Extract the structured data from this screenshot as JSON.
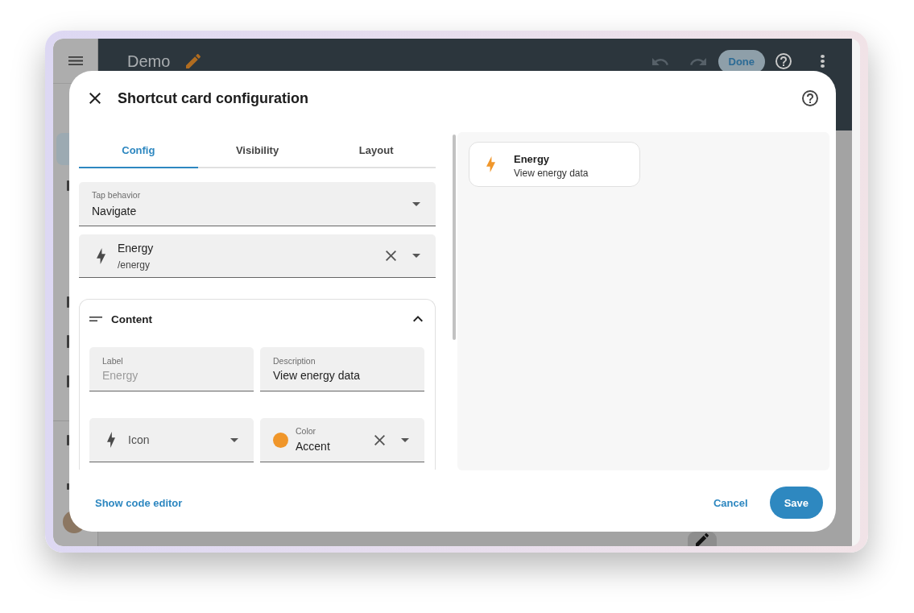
{
  "background_app": {
    "sidebar": {
      "items": [
        {
          "selected": true
        },
        {
          "selected": false
        },
        {
          "selected": false
        },
        {
          "selected": false
        },
        {
          "selected": false
        },
        {
          "selected": false
        },
        {
          "selected": false
        }
      ]
    },
    "toolbar": {
      "title": "Demo",
      "done_button": "Done"
    }
  },
  "dialog": {
    "title": "Shortcut card configuration",
    "tabs": [
      {
        "label": "Config",
        "selected": true
      },
      {
        "label": "Visibility",
        "selected": false
      },
      {
        "label": "Layout",
        "selected": false
      }
    ],
    "fields": [
      {
        "kind": "select",
        "label": "Tap behavior",
        "value": "Navigate"
      },
      {
        "kind": "navigation",
        "value": "Energy",
        "secondary": "/energy"
      }
    ],
    "section": {
      "title": "Content",
      "expanded": true,
      "fields": [
        {
          "kind": "text",
          "label": "Label",
          "placeholder": "Energy"
        },
        {
          "kind": "text",
          "label": "Description",
          "value": "View energy data"
        },
        {
          "kind": "icon",
          "label": "Icon"
        },
        {
          "kind": "color",
          "label": "Color",
          "value": "Accent",
          "color": "#f0962a"
        }
      ]
    },
    "preview": {
      "name": "Energy",
      "description": "View energy data"
    },
    "footer": {
      "code_editor_link": "Show code editor",
      "cancel_button": "Cancel",
      "save_button": "Save"
    }
  }
}
